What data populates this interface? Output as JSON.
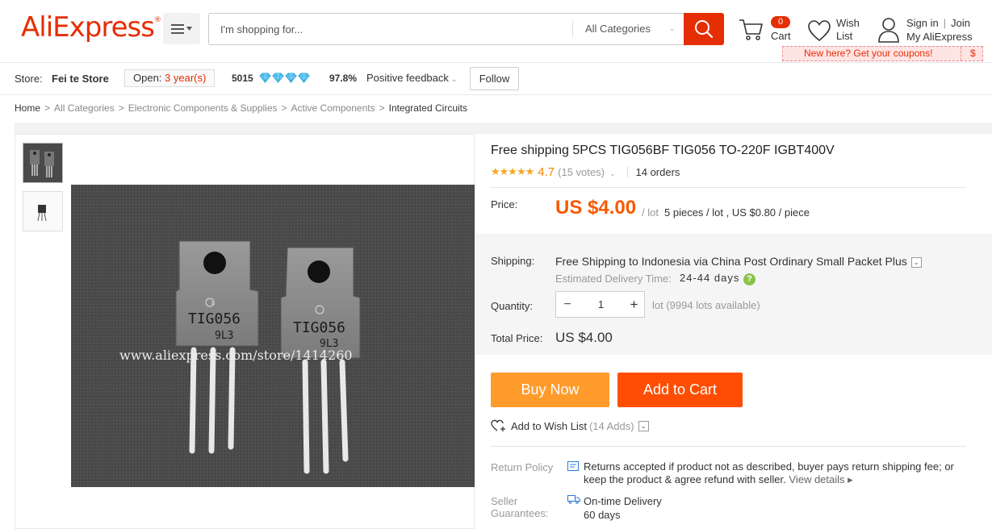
{
  "header": {
    "logo_text": "AliExpress",
    "logo_mark": "®",
    "search_placeholder": "I'm shopping for...",
    "category_select": "All Categories",
    "cart_count": "0",
    "cart_label": "Cart",
    "wish_label_1": "Wish",
    "wish_label_2": "List",
    "sign_in": "Sign in",
    "join": "Join",
    "my_account": "My AliExpress",
    "coupon_text": "New here? Get your coupons!",
    "coupon_dollar": "$",
    "brand_color": "#e62e04"
  },
  "store": {
    "label": "Store:",
    "name": "Fei te Store",
    "open_prefix": "Open:",
    "open_years": "3 year(s)",
    "score": "5015",
    "diamond_count": 4,
    "feedback_pct": "97.8%",
    "feedback_label": "Positive feedback",
    "follow_label": "Follow"
  },
  "breadcrumb": [
    "Home",
    "All Categories",
    "Electronic Components & Supplies",
    "Active Components",
    "Integrated Circuits"
  ],
  "breadcrumb_sep": ">",
  "product": {
    "title": "Free shipping 5PCS TIG056BF TIG056 TO-220F IGBT400V",
    "stars": "★★★★★",
    "rating": "4.7",
    "votes": "(15 votes)",
    "orders": "14 orders",
    "price_label": "Price:",
    "price": "US $4.00",
    "price_unit": "/ lot",
    "price_extra": "5 pieces / lot , US $0.80 / piece",
    "photo_watermark": "www.aliexpress.com/store/1414260",
    "chip_label_1": "TIG056",
    "chip_code_1": "9L3",
    "chip_label_2": "TIG056",
    "chip_code_2": "9L3",
    "chip_logo": "L"
  },
  "shipping": {
    "label": "Shipping:",
    "text": "Free Shipping to Indonesia via China Post Ordinary Small Packet Plus",
    "est_label": "Estimated Delivery Time:",
    "est_value": "24-44 days",
    "help": "?"
  },
  "quantity": {
    "label": "Quantity:",
    "minus": "−",
    "value": "1",
    "plus": "+",
    "available": "lot (9994 lots available)"
  },
  "total": {
    "label": "Total Price:",
    "value": "US $4.00"
  },
  "actions": {
    "buy_now": "Buy Now",
    "add_to_cart": "Add to Cart",
    "wishlist": "Add to Wish List",
    "wishlist_adds": "(14 Adds)",
    "buy_color": "#ff9b2b",
    "cart_color": "#ff4e04"
  },
  "policy": {
    "return_label": "Return Policy",
    "return_text": "Returns accepted if product not as described, buyer pays return shipping fee; or keep the product & agree refund with seller.",
    "view_details": "View details",
    "guarantee_label": "Seller Guarantees:",
    "guarantee_line1": "On-time Delivery",
    "guarantee_line2": "60 days"
  }
}
